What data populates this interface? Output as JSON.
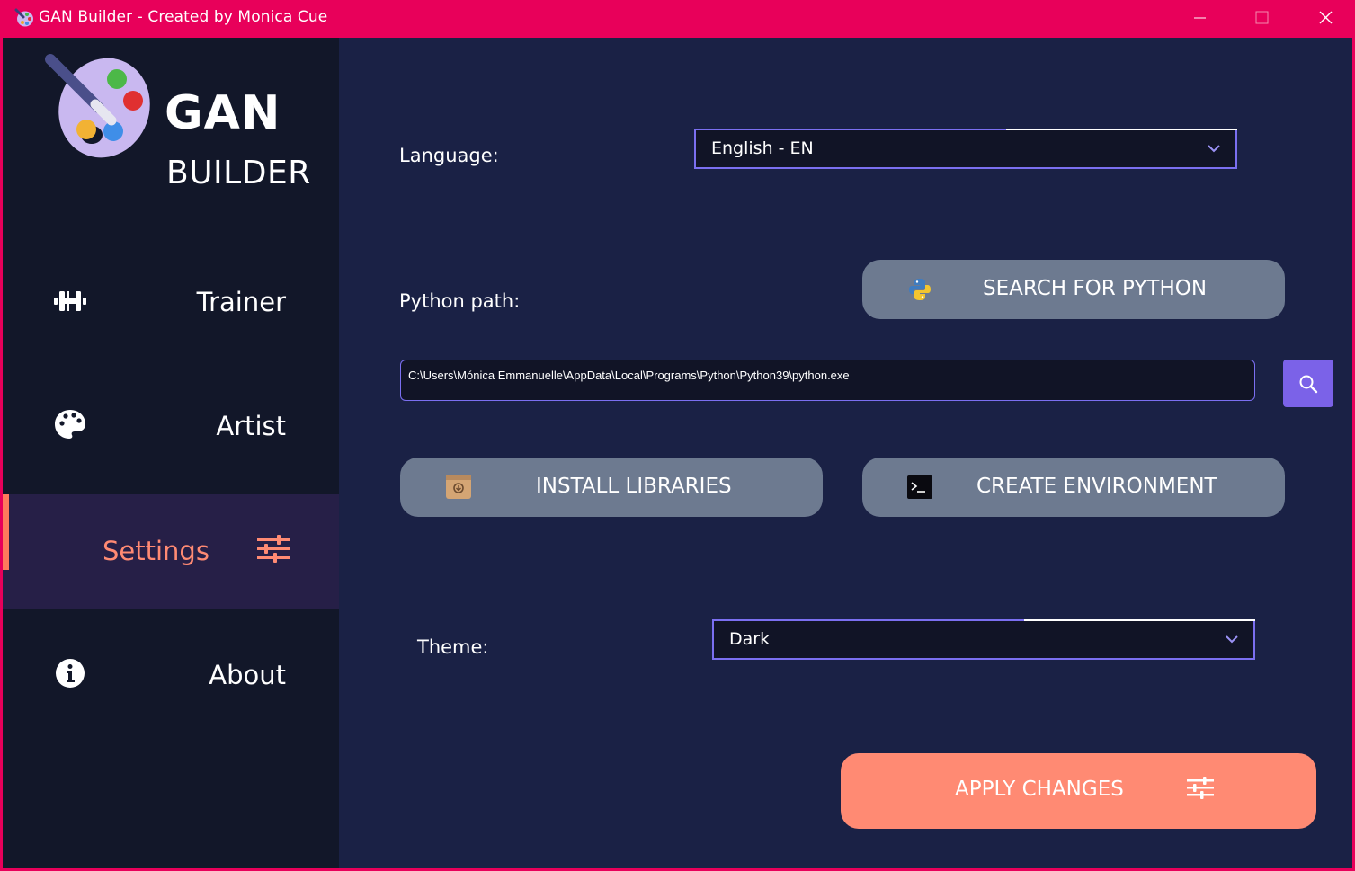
{
  "window": {
    "title": "GAN Builder - Created by Monica Cue",
    "minimize_icon": "minimize-icon",
    "maximize_icon": "maximize-icon",
    "close_icon": "close-icon"
  },
  "logo": {
    "line1": "GAN",
    "line2": "BUILDER",
    "icon": "palette-brush-icon"
  },
  "sidebar": {
    "items": [
      {
        "label": "Trainer",
        "icon": "dumbbell-icon",
        "active": false
      },
      {
        "label": "Artist",
        "icon": "palette-icon",
        "active": false
      },
      {
        "label": "Settings",
        "icon": "sliders-icon",
        "active": true
      },
      {
        "label": "About",
        "icon": "info-icon",
        "active": false
      }
    ],
    "active_color": "#ff8a73"
  },
  "settings": {
    "language_label": "Language:",
    "language_value": "English - EN",
    "python_label": "Python path:",
    "search_python_label": "SEARCH FOR PYTHON",
    "python_path_value": "C:\\Users\\Mónica Emmanuelle\\AppData\\Local\\Programs\\Python\\Python39\\python.exe",
    "install_label": "INSTALL LIBRARIES",
    "create_env_label": "CREATE ENVIRONMENT",
    "theme_label": "Theme:",
    "theme_value": "Dark",
    "apply_label": "APPLY CHANGES"
  },
  "colors": {
    "titlebar": "#e8005a",
    "sidebar_bg": "#121729",
    "main_bg": "#1a2145",
    "accent_purple": "#7b6ff0",
    "button_gray": "#6d7a90",
    "apply_orange": "#ff8a73"
  }
}
